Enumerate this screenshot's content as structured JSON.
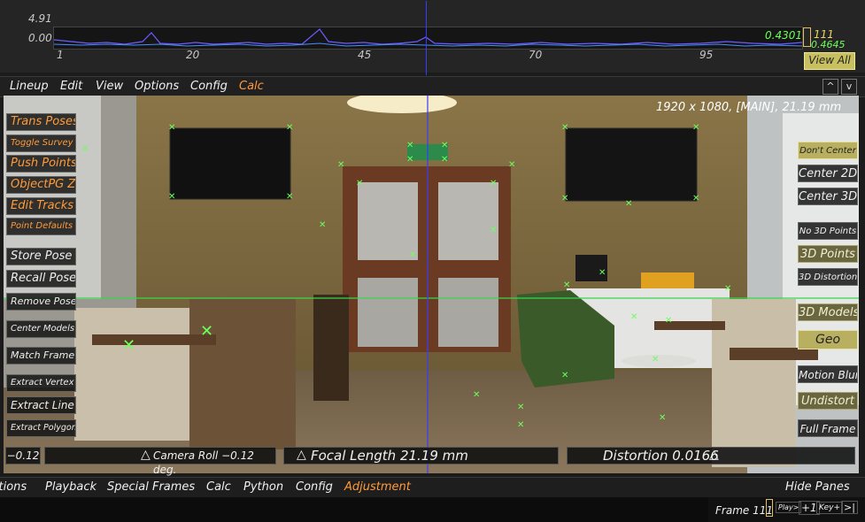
{
  "graph": {
    "y_max": "4.91",
    "y_min": "0.00",
    "x_ticks": [
      "1",
      "20",
      "45",
      "70",
      "95"
    ],
    "value_green": "0.4301",
    "value_yellow": "111",
    "value_green2": "0.4645",
    "view_all": "View All"
  },
  "menubar": {
    "items": [
      "Lineup",
      "Edit",
      "View",
      "Options",
      "Config",
      "Calc"
    ],
    "up_arrow": "^",
    "down_arrow": "v"
  },
  "viewport": {
    "resolution_label": "1920 x 1080, [MAIN], 21.19 mm",
    "exit_sign": "EXIT"
  },
  "left_panel": {
    "buttons": [
      "Trans Poses",
      "Toggle Survey",
      "Push Points",
      "ObjectPG Z",
      "Edit Tracks",
      "Point Defaults",
      "Store Pose",
      "Recall Pose",
      "Remove Pose",
      "Center Models",
      "Match Frame",
      "Extract Vertex",
      "Extract Line",
      "Extract Polygon"
    ]
  },
  "right_panel": {
    "buttons": [
      "Don't Center",
      "Center 2D",
      "Center 3D",
      "No 3D Points",
      "3D Points",
      "3D Distortion",
      "3D Models",
      "Geo",
      "Motion Blur",
      "Undistort",
      "Full Frame"
    ]
  },
  "sliders": {
    "value_box": "−0.12",
    "camera_roll": "Camera Roll −0.12 deg.",
    "focal_length": "Focal Length 21.19 mm",
    "distortion": "Distortion 0.0166"
  },
  "bottom_menu": {
    "items": [
      "Options",
      "Playback",
      "Special Frames",
      "Calc",
      "Python",
      "Config",
      "Adjustment"
    ],
    "hide_panes": "Hide Panes"
  },
  "timeline": {
    "frame_label": "Frame 111",
    "play": "Play>",
    "plus_one": "+1",
    "key_plus": "Key+",
    "end": ">|"
  },
  "colors": {
    "accent_orange": "#ff9a3c",
    "tracker_green": "#6cff5c",
    "button_yellow": "#c8c060"
  }
}
